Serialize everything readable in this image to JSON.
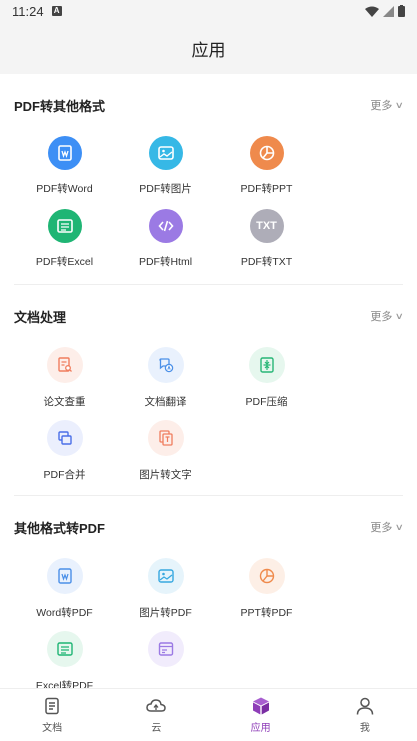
{
  "status": {
    "time": "11:24"
  },
  "header": {
    "title": "应用"
  },
  "sections": [
    {
      "title": "PDF转其他格式",
      "more": "更多",
      "items": [
        {
          "label": "PDF转Word",
          "icon": "word-doc-icon",
          "color": "#3d8ff5"
        },
        {
          "label": "PDF转图片",
          "icon": "image-icon",
          "color": "#36b8e6"
        },
        {
          "label": "PDF转PPT",
          "icon": "pie-chart-icon",
          "color": "#ef8a4c"
        },
        {
          "label": "PDF转Excel",
          "icon": "excel-sheet-icon",
          "color": "#1fb574"
        },
        {
          "label": "PDF转Html",
          "icon": "code-icon",
          "color": "#9b7ae4"
        },
        {
          "label": "PDF转TXT",
          "icon": "txt-icon",
          "color": "#aeadb8",
          "glyph": "TXT"
        }
      ]
    },
    {
      "title": "文档处理",
      "more": "更多",
      "items": [
        {
          "label": "论文查重",
          "icon": "doc-search-icon",
          "color": "#f07d5e",
          "bg": "#fdeee9"
        },
        {
          "label": "文档翻译",
          "icon": "translate-icon",
          "color": "#4a8fe8",
          "bg": "#e9f1fd"
        },
        {
          "label": "PDF压缩",
          "icon": "compress-icon",
          "color": "#27b676",
          "bg": "#e6f7ee"
        },
        {
          "label": "PDF合并",
          "icon": "merge-icon",
          "color": "#4a6fe8",
          "bg": "#ebeffd"
        },
        {
          "label": "图片转文字",
          "icon": "image-text-icon",
          "color": "#f07d5e",
          "bg": "#fdeee9"
        }
      ]
    },
    {
      "title": "其他格式转PDF",
      "more": "更多",
      "items": [
        {
          "label": "Word转PDF",
          "icon": "word-doc-icon",
          "color": "#4a8fe8",
          "bg": "#e9f1fd"
        },
        {
          "label": "图片转PDF",
          "icon": "image-icon",
          "color": "#36a8e0",
          "bg": "#e6f4fb"
        },
        {
          "label": "PPT转PDF",
          "icon": "pie-chart-icon",
          "color": "#ef8a4c",
          "bg": "#fdefe6"
        },
        {
          "label": "Excel转PDF",
          "icon": "excel-sheet-icon",
          "color": "#1fb574",
          "bg": "#e6f7ee"
        },
        {
          "label": "",
          "icon": "web-page-icon",
          "color": "#9b7ae4",
          "bg": "#f1ecfc"
        }
      ]
    }
  ],
  "tabs": [
    {
      "label": "文档",
      "icon": "document-tab-icon"
    },
    {
      "label": "云",
      "icon": "cloud-tab-icon"
    },
    {
      "label": "应用",
      "icon": "apps-cube-icon",
      "active": true,
      "color": "#8e3db8"
    },
    {
      "label": "我",
      "icon": "person-tab-icon"
    }
  ]
}
